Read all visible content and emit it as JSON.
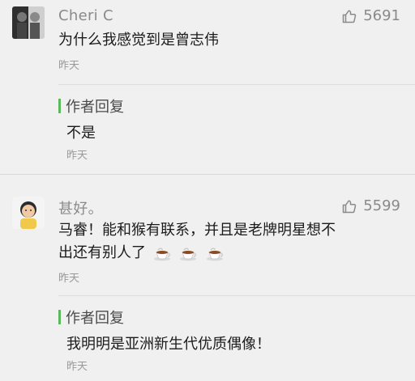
{
  "comments": [
    {
      "username": "Cheri C",
      "likes": "5691",
      "text_lines": [
        "为什么我感觉到是曾志伟"
      ],
      "time": "昨天",
      "reply": {
        "label": "作者回复",
        "text": "不是",
        "time": "昨天"
      },
      "avatar_icon": "two-men-photo"
    },
    {
      "username": "甚好。",
      "likes": "5599",
      "text_lines": [
        "马睿！能和猴有联系，并且是老牌明星想不",
        "出还有别人了"
      ],
      "emoji": [
        "teacup",
        "teacup",
        "teacup"
      ],
      "time": "昨天",
      "reply": {
        "label": "作者回复",
        "text": "我明明是亚洲新生代优质偶像！",
        "time": "昨天"
      },
      "avatar_icon": "child-photo"
    }
  ],
  "colors": {
    "background": "#f0f0f0",
    "reply_accent": "#5cb85c",
    "meta_text": "#8a8a8a"
  }
}
